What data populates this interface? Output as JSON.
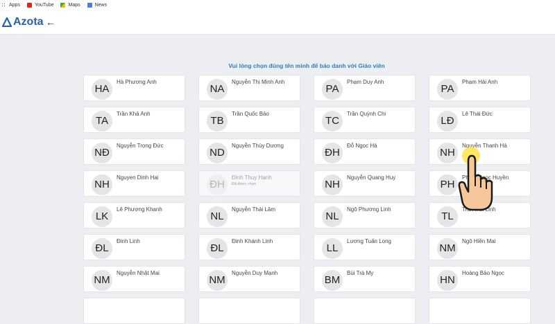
{
  "bookmarks": [
    {
      "label": "Apps",
      "icon": "apps-icon"
    },
    {
      "label": "YouTube",
      "icon": "youtube-icon"
    },
    {
      "label": "Maps",
      "icon": "maps-icon"
    },
    {
      "label": "News",
      "icon": "news-icon"
    }
  ],
  "header": {
    "logo_text": "Azota",
    "back_icon": "back-arrow-icon"
  },
  "prompt": "Vui lòng chọn đúng tên mình để báo danh với Giáo viên",
  "students": [
    {
      "initials": "HA",
      "name": "Hà Phương Anh"
    },
    {
      "initials": "NA",
      "name": "Nguyễn Thị Minh Anh"
    },
    {
      "initials": "PA",
      "name": "Phạm Duy Anh"
    },
    {
      "initials": "PA",
      "name": "Phạm Hải Anh"
    },
    {
      "initials": "TA",
      "name": "Trần Khả Anh"
    },
    {
      "initials": "TB",
      "name": "Trần Quốc Bảo"
    },
    {
      "initials": "TC",
      "name": "Trần Quỳnh Chi"
    },
    {
      "initials": "LĐ",
      "name": "Lê Thái Đức"
    },
    {
      "initials": "NĐ",
      "name": "Nguyễn Trọng Đức"
    },
    {
      "initials": "ND",
      "name": "Nguyễn Thùy Dương"
    },
    {
      "initials": "ĐH",
      "name": "Đỗ Ngọc Hà"
    },
    {
      "initials": "NH",
      "name": "Nguyễn Thanh Hà"
    },
    {
      "initials": "NH",
      "name": "Nguyen Dinh Hai"
    },
    {
      "initials": "ĐH",
      "name": "Đinh Thuy Hạnh",
      "status": "Đã được chọn",
      "disabled": true
    },
    {
      "initials": "NH",
      "name": "Nguyễn Quang Huy"
    },
    {
      "initials": "PH",
      "name": "Phạm Ngọc Huyền"
    },
    {
      "initials": "LK",
      "name": "Lê Phương Khanh"
    },
    {
      "initials": "NL",
      "name": "Nguyễn Thái Lâm"
    },
    {
      "initials": "NL",
      "name": "Ngô Phương Linh"
    },
    {
      "initials": "TL",
      "name": "Trần Mai Linh"
    },
    {
      "initials": "ĐL",
      "name": "Đinh Linh"
    },
    {
      "initials": "ĐL",
      "name": "Đinh Khánh Linh"
    },
    {
      "initials": "LL",
      "name": "Lương Tuấn Long"
    },
    {
      "initials": "NM",
      "name": "Ngô Hiền Mai"
    },
    {
      "initials": "NM",
      "name": "Nguyễn Nhật Mai"
    },
    {
      "initials": "NM",
      "name": "Nguyễn Duy Mạnh"
    },
    {
      "initials": "BM",
      "name": "Bùi Trà My"
    },
    {
      "initials": "HN",
      "name": "Hoàng Bảo Ngọc"
    }
  ],
  "cursor_icon": "pointing-hand-icon"
}
